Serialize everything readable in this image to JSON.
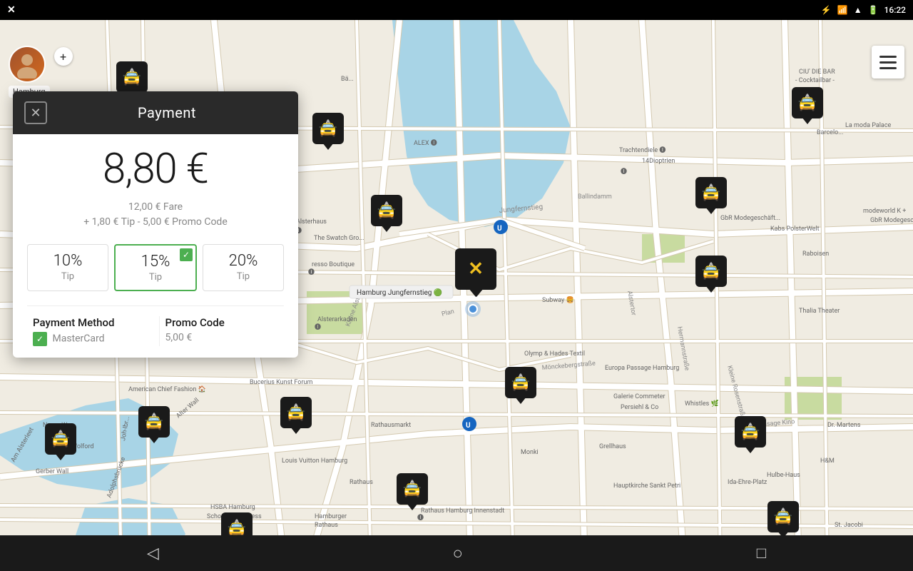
{
  "statusBar": {
    "appIcon": "✕",
    "bluetooth": "bluetooth-icon",
    "signal": "signal-icon",
    "wifi": "wifi-icon",
    "battery": "battery-icon",
    "time": "16:22"
  },
  "header": {
    "closeLabel": "✕",
    "title": "Payment"
  },
  "payment": {
    "amount": "8,80 €",
    "fareLabel": "12,00 € Fare",
    "breakdownLabel": "+ 1,80 € Tip - 5,00 € Promo Code",
    "tips": [
      {
        "percent": "10%",
        "label": "Tip",
        "selected": false
      },
      {
        "percent": "15%",
        "label": "Tip",
        "selected": true
      },
      {
        "percent": "20%",
        "label": "Tip",
        "selected": false
      }
    ],
    "paymentMethod": {
      "label": "Payment Method",
      "value": "MasterCard"
    },
    "promoCode": {
      "label": "Promo Code",
      "value": "5,00 €"
    }
  },
  "location": {
    "city": "Hamburg"
  },
  "nav": {
    "back": "◁",
    "home": "○",
    "recent": "□"
  }
}
